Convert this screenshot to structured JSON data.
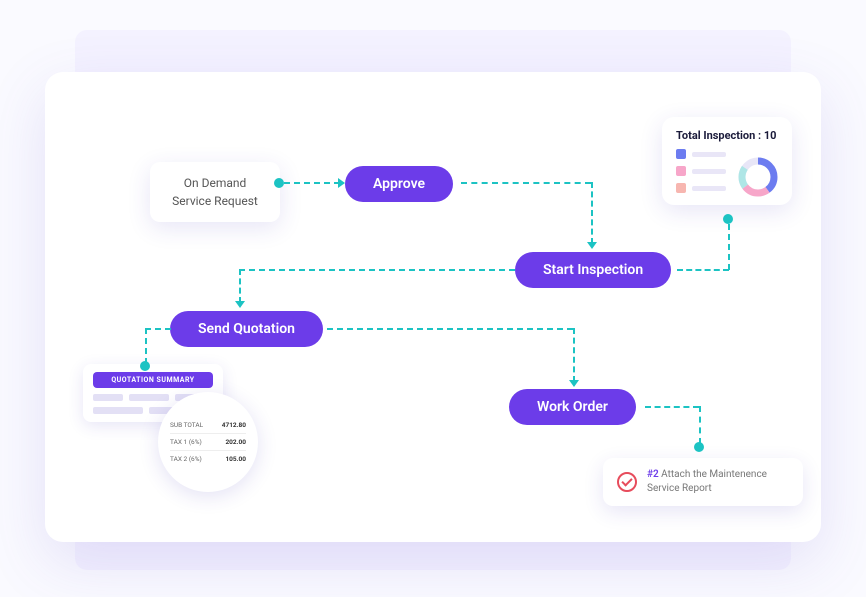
{
  "nodes": {
    "on_demand_line1": "On Demand",
    "on_demand_line2": "Service Request",
    "approve": "Approve",
    "start_inspection": "Start Inspection",
    "send_quotation": "Send Quotation",
    "work_order": "Work Order"
  },
  "inspection_card": {
    "title": "Total Inspection : 10",
    "legend": [
      {
        "color": "#6c7cf0"
      },
      {
        "color": "#f7a6c9"
      },
      {
        "color": "#f7b6b0"
      }
    ]
  },
  "quotation_card": {
    "header": "QUOTATION SUMMARY",
    "rows": [
      {
        "label": "SUB TOTAL",
        "value": "4712.80"
      },
      {
        "label": "TAX 1 (6%)",
        "value": "202.00"
      },
      {
        "label": "TAX 2 (6%)",
        "value": "105.00"
      }
    ]
  },
  "attach_card": {
    "num": "#2",
    "text": " Attach the Maintenence Service Report"
  },
  "colors": {
    "primary": "#6c3ce9",
    "teal": "#1cc3c3"
  }
}
